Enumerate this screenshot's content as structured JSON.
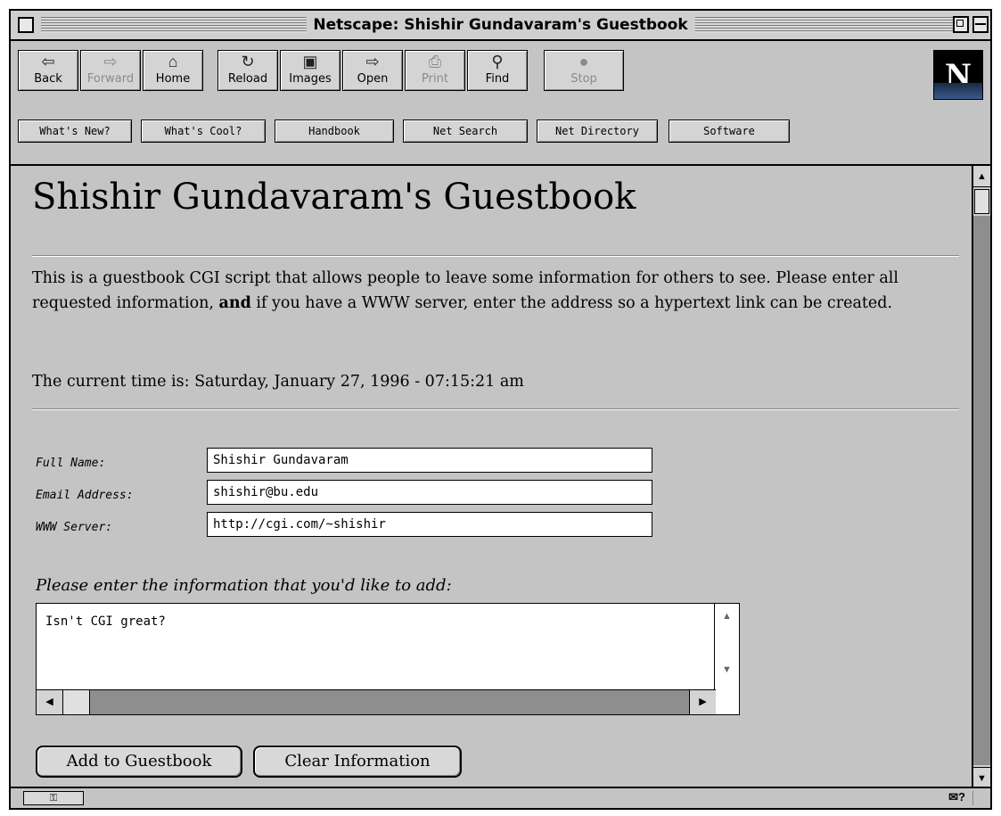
{
  "window": {
    "title": "Netscape: Shishir Gundavaram's Guestbook"
  },
  "toolbar": {
    "buttons": [
      {
        "label": "Back",
        "icon": "back-arrow-icon",
        "enabled": true
      },
      {
        "label": "Forward",
        "icon": "forward-arrow-icon",
        "enabled": false
      },
      {
        "label": "Home",
        "icon": "home-icon",
        "enabled": true
      },
      {
        "label": "Reload",
        "icon": "reload-icon",
        "enabled": true
      },
      {
        "label": "Images",
        "icon": "images-icon",
        "enabled": true
      },
      {
        "label": "Open",
        "icon": "open-icon",
        "enabled": true
      },
      {
        "label": "Print",
        "icon": "print-icon",
        "enabled": false
      },
      {
        "label": "Find",
        "icon": "find-icon",
        "enabled": true
      },
      {
        "label": "Stop",
        "icon": "stop-icon",
        "enabled": false
      }
    ],
    "directory_buttons": [
      "What's New?",
      "What's Cool?",
      "Handbook",
      "Net Search",
      "Net Directory",
      "Software"
    ]
  },
  "page": {
    "heading": "Shishir Gundavaram's Guestbook",
    "intro_a": "This is a guestbook CGI script that allows people to leave some information for others to see. Please enter all requested information, ",
    "intro_bold": "and",
    "intro_b": " if you have a WWW server, enter the address so a hypertext link can be created.",
    "time_text": "The current time is: Saturday, January 27, 1996 - 07:15:21 am",
    "fields": {
      "name_label": "Full Name:",
      "name_value": "Shishir Gundavaram",
      "email_label": "Email Address:",
      "email_value": "shishir@bu.edu",
      "www_label": "WWW Server:",
      "www_value": "http://cgi.com/~shishir"
    },
    "prompt": "Please enter the information that you'd like to add:",
    "message": "Isn't CGI great?",
    "submit_label": "Add to Guestbook",
    "clear_label": "Clear Information"
  }
}
